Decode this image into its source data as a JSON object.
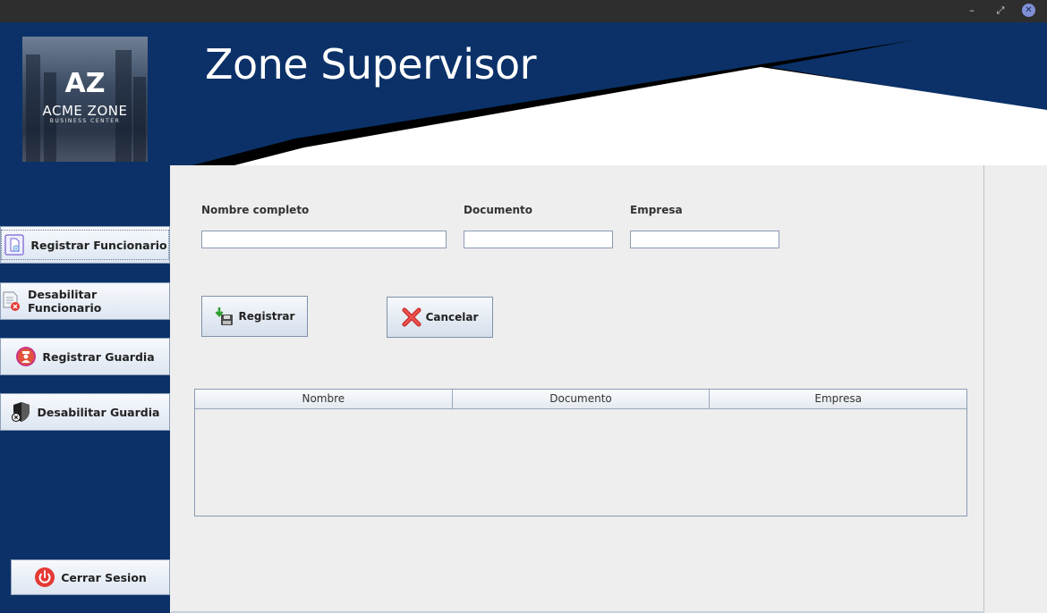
{
  "window": {
    "minimize_glyph": "–",
    "maximize_glyph": "⤢",
    "close_glyph": "✕"
  },
  "header": {
    "title": "Zone Supervisor",
    "logo": {
      "mark": "AZ",
      "name": "ACME ZONE",
      "subtitle": "BUSINESS CENTER"
    }
  },
  "sidebar": {
    "items": [
      {
        "label": "Registrar Funcionario",
        "icon": "document-add-icon"
      },
      {
        "label": "Desabilitar Funcionario",
        "icon": "document-remove-icon"
      },
      {
        "label": "Registrar Guardia",
        "icon": "guard-icon"
      },
      {
        "label": "Desabilitar Guardia",
        "icon": "shield-disable-icon"
      }
    ],
    "logout_label": "Cerrar Sesion",
    "logout_icon": "power-icon"
  },
  "form": {
    "nombre_label": "Nombre completo",
    "nombre_value": "",
    "documento_label": "Documento",
    "documento_value": "",
    "empresa_label": "Empresa",
    "empresa_value": "",
    "registrar_label": "Registrar",
    "cancelar_label": "Cancelar"
  },
  "table": {
    "columns": [
      "Nombre",
      "Documento",
      "Empresa"
    ],
    "rows": []
  },
  "colors": {
    "brand_navy": "#0b3168",
    "accent_red": "#e53935",
    "accent_green": "#2e9e2e"
  }
}
